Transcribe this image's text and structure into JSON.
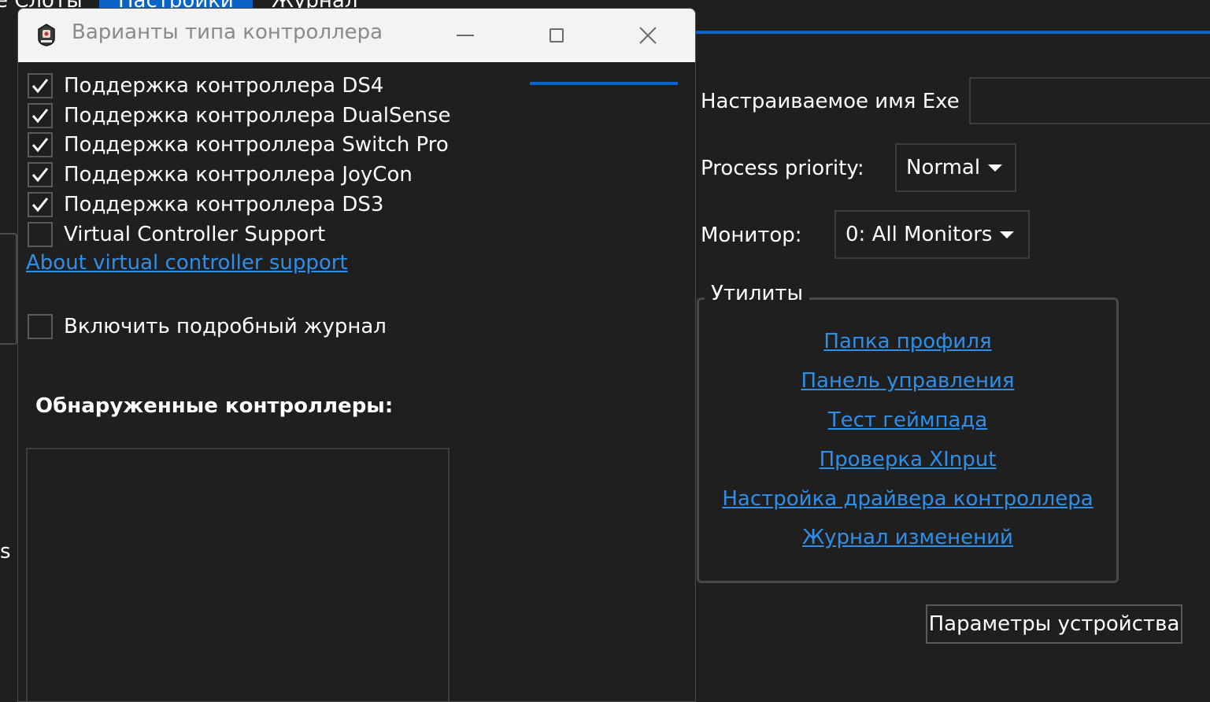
{
  "background": {
    "tabs": [
      {
        "label": "Слоты"
      },
      {
        "label": "Настройки"
      },
      {
        "label": "Журнал"
      }
    ],
    "custom_exe_label": "Настраиваемое имя Exe",
    "custom_exe_value": "",
    "process_priority_label": "Process priority:",
    "process_priority_value": "Normal",
    "monitor_label": "Монитор:",
    "monitor_value": "0: All Monitors",
    "partial_left_text": "s",
    "utilities": {
      "title": "Утилиты",
      "links": [
        "Папка профиля",
        "Панель управления",
        "Тест геймпада",
        "Проверка XInput",
        "Настройка драйвера контроллера",
        "Журнал изменений"
      ]
    },
    "device_settings_button": "Параметры устройства"
  },
  "dialog": {
    "title": "Варианты типа контроллера",
    "options": [
      {
        "label": "Поддержка контроллера DS4",
        "checked": true
      },
      {
        "label": "Поддержка контроллера DualSense",
        "checked": true
      },
      {
        "label": "Поддержка контроллера Switch Pro",
        "checked": true
      },
      {
        "label": "Поддержка контроллера JoyCon",
        "checked": true
      },
      {
        "label": "Поддержка контроллера DS3",
        "checked": true
      },
      {
        "label": "Virtual Controller Support",
        "checked": false
      }
    ],
    "about_link": "About virtual controller support",
    "verbose_log": {
      "label": "Включить подробный журнал",
      "checked": false
    },
    "detected_title": "Обнаруженные контроллеры:",
    "detected_controllers": []
  },
  "colors": {
    "accent": "#0a64c8",
    "link": "#2f8fe8",
    "background": "#1f1f1f"
  }
}
